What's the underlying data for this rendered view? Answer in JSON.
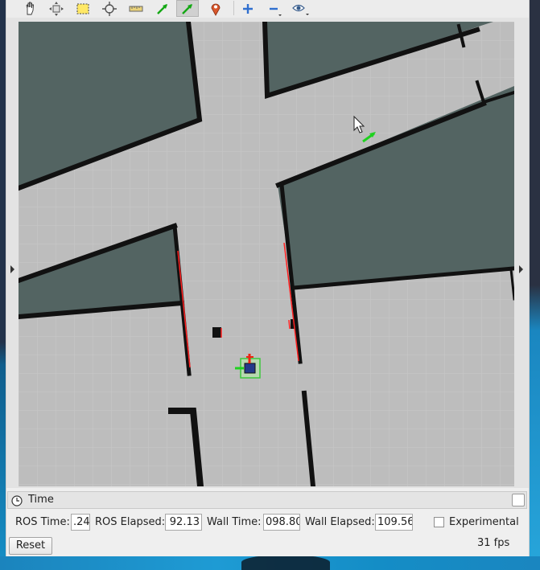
{
  "toolbar": {
    "tools": [
      {
        "icon": "interact-hand-icon"
      },
      {
        "icon": "move-camera-icon"
      },
      {
        "icon": "select-icon"
      },
      {
        "icon": "focus-camera-icon"
      },
      {
        "icon": "measure-icon"
      },
      {
        "icon": "2d-pose-estimate-icon"
      },
      {
        "icon": "2d-nav-goal-icon",
        "active": true
      },
      {
        "icon": "publish-point-icon"
      },
      {
        "icon": "add-tool-icon"
      },
      {
        "icon": "remove-tool-icon"
      },
      {
        "icon": "view-eye-icon"
      }
    ]
  },
  "colors": {
    "free_space": "#bdbdbd",
    "unknown_space": "#536462",
    "wall": "#111111",
    "laser_scan": "#ff2020",
    "nav_goal": "#1fd21f",
    "robot_footprint": "#36c836"
  },
  "time_panel": {
    "title": "Time",
    "ros_time_label": "ROS Time:",
    "ros_time": ".24",
    "ros_elapsed_label": "ROS Elapsed:",
    "ros_elapsed": "92.13",
    "wall_time_label": "Wall Time:",
    "wall_time": "098.80",
    "wall_elapsed_label": "Wall Elapsed:",
    "wall_elapsed": "109.56",
    "experimental_label": "Experimental",
    "experimental_checked": false,
    "reset_label": "Reset",
    "fps": "31 fps"
  }
}
